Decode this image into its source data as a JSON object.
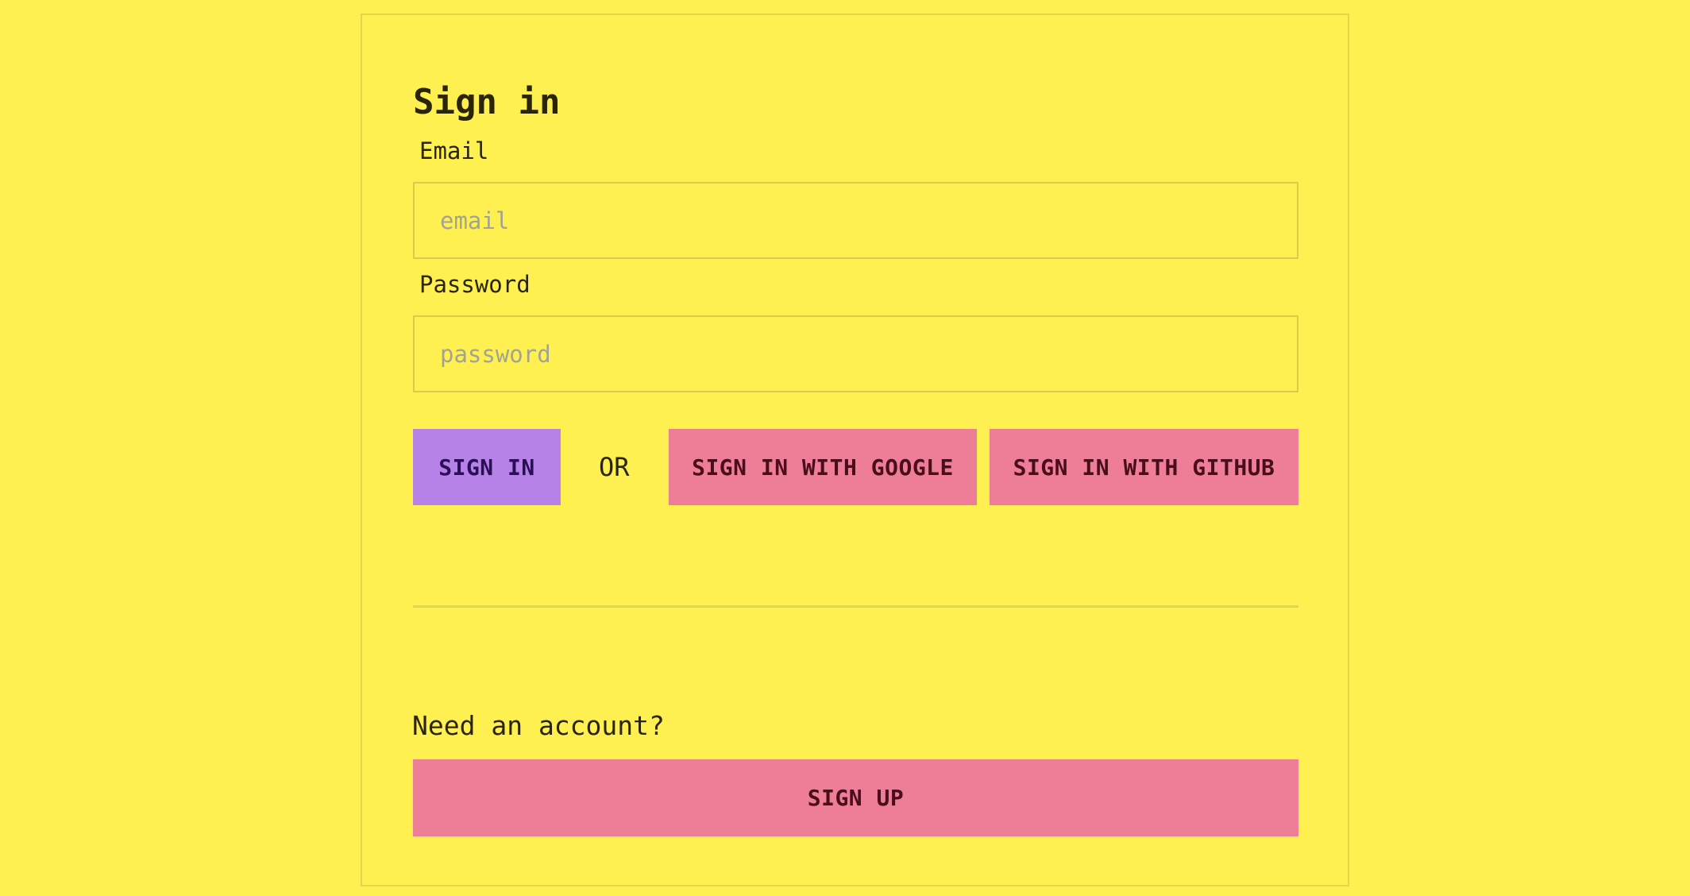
{
  "form": {
    "title": "Sign in",
    "email": {
      "label": "Email",
      "placeholder": "email",
      "value": ""
    },
    "password": {
      "label": "Password",
      "placeholder": "password",
      "value": ""
    },
    "sign_in_label": "SIGN IN",
    "or_text": "OR",
    "google_label": "SIGN IN WITH GOOGLE",
    "github_label": "SIGN IN WITH GITHUB"
  },
  "signup": {
    "prompt": "Need an account?",
    "button_label": "SIGN UP"
  },
  "colors": {
    "background": "#fef051",
    "primary_button": "#b682e8",
    "secondary_button": "#ee7d97"
  }
}
